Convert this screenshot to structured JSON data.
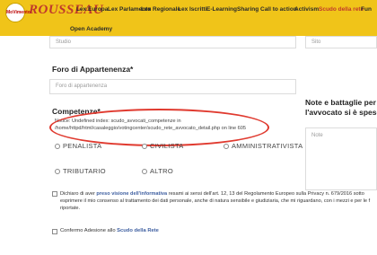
{
  "brand": {
    "logo_badge_text": "MoVimento",
    "logo_script_text": "ROUSSEAU",
    "colors": {
      "navbar": "#f0c419",
      "accent_red": "#c0392b",
      "link_blue": "#3d5ea0",
      "highlight_ellipse": "#e03a2f"
    }
  },
  "nav": {
    "items": [
      "Lex Europa",
      "Lex Parlamento",
      "Lex Regionale",
      "Lex Iscritti",
      "E-Learning",
      "Sharing",
      "Call to action",
      "Activism",
      "Scudo della rete",
      "Fun"
    ],
    "second_row": "Open Academy"
  },
  "form": {
    "studio_placeholder": "Studio",
    "sito_placeholder": "Sito",
    "foro_label": "Foro di Appartenenza*",
    "foro_placeholder": "Foro di appartenenza",
    "competenze_label": "Competenze*",
    "warning_line1": "Notice: Undefined index: scudo_avvocati_competenze in",
    "warning_line2": "/home/httpd/html/casaleggio/votingcenter/scudo_rete_avvocato_detail.php on line 605",
    "options": [
      "PENALISTA",
      "CIVILISTA",
      "AMMINISTRATIVISTA",
      "TRIBUTARIO",
      "ALTRO"
    ],
    "note_label_line1": "Note e battaglie per l",
    "note_label_line2": "l'avvocato si è speso",
    "note_placeholder": "Note",
    "privacy_prefix": "Dichiaro di aver ",
    "privacy_link": "preso visione dell'informativa",
    "privacy_rest_line1": " resami ai sensi dell'art. 12, 13 del Regolamento Europeo sulla Privacy n. 679/2016 sotto",
    "privacy_line2": "esprimere il mio consenso al trattamento dei dati personale, anche di natura sensibile e giudiziaria, che mi riguardano, con i mezzi e per le f",
    "privacy_line3": "riportate.",
    "confirm_prefix": "Confermo Adesione allo ",
    "confirm_link": "Scudo della Rete"
  }
}
